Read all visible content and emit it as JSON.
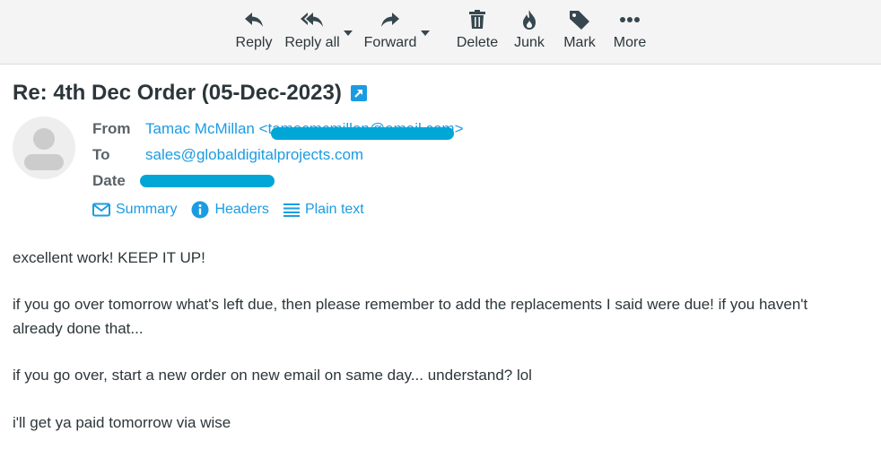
{
  "toolbar": {
    "reply": "Reply",
    "reply_all": "Reply all",
    "forward": "Forward",
    "delete": "Delete",
    "junk": "Junk",
    "mark": "Mark",
    "more": "More"
  },
  "message": {
    "subject": "Re: 4th Dec Order (05-Dec-2023)",
    "from_label": "From",
    "from_value": "Tamac McMillan <tamacmcmillan@email.com>",
    "to_label": "To",
    "to_value": "sales@globaldigitalprojects.com",
    "date_label": "Date",
    "date_value": ""
  },
  "view_links": {
    "summary": "Summary",
    "headers": "Headers",
    "plain_text": "Plain text"
  },
  "body": {
    "p1": "excellent work! KEEP IT UP!",
    "p2": "if you go over tomorrow what's left due, then please remember to add the replacements I said were due! if you haven't already done that...",
    "p3": "if you go over, start a new order on new email on same day... understand? lol",
    "p4": "i'll get ya paid tomorrow via wise"
  },
  "colors": {
    "accent": "#1b9ce2",
    "redaction": "#00a6d6",
    "toolbar_bg": "#f4f4f4"
  }
}
